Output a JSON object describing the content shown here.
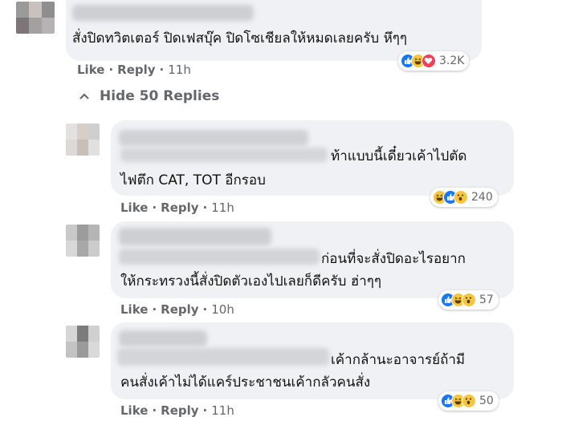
{
  "comment": {
    "text": "สั่งปิดทวิตเตอร์ ปิดเฟสบุ๊ค ปิดโซเชียลให้หมดเลยครับ หึๆๆ",
    "like_label": "Like",
    "reply_label": "Reply",
    "time": "11h",
    "reactions": [
      "like",
      "haha",
      "love"
    ],
    "reaction_count": "3.2K"
  },
  "hide_replies_label": "Hide 50 Replies",
  "replies": [
    {
      "line1": "ท้าแบบนี้เดี๋ยวเค้าไปตัด",
      "line2": "ไฟตึก CAT, TOT อีกรอบ",
      "like_label": "Like",
      "reply_label": "Reply",
      "time": "11h",
      "reactions": [
        "haha",
        "like",
        "wow"
      ],
      "reaction_count": "240"
    },
    {
      "line1": "ก่อนที่จะสั่งปิดอะไรอยาก",
      "line2": "ให้กระทรวงนี้สั่งปิดตัวเองไปเลยก็ดีครับ ฮ่าๆๆ",
      "like_label": "Like",
      "reply_label": "Reply",
      "time": "10h",
      "reactions": [
        "like",
        "haha",
        "wow"
      ],
      "reaction_count": "57"
    },
    {
      "line1": "เค้ากล้านะอาจารย์ถ้ามี",
      "line2": "คนสั่งเค้าไม่ได้แคร์ประชาชนเค้ากลัวคนสั่ง",
      "like_label": "Like",
      "reply_label": "Reply",
      "time": "11h",
      "reactions": [
        "like",
        "haha",
        "wow"
      ],
      "reaction_count": "50"
    }
  ],
  "colors": {
    "bubble": "#eff1f4",
    "meta_text": "#65676b",
    "like_blue": "#1877f2",
    "haha_yellow": "#f7c63f",
    "love_red": "#f33e58"
  }
}
